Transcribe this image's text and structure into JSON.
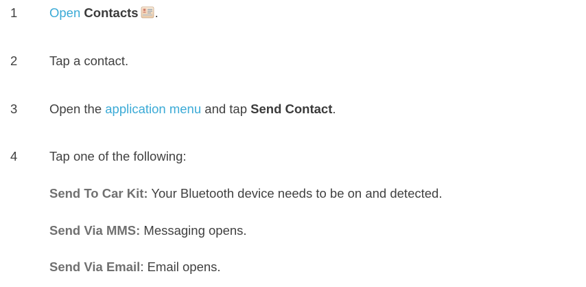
{
  "steps": [
    {
      "number": "1",
      "link": "Open",
      "space": " ",
      "bold": "Contacts",
      "icon": "contacts-app-icon",
      "end": "."
    },
    {
      "number": "2",
      "text": "Tap a contact."
    },
    {
      "number": "3",
      "prefix": "Open the ",
      "link": "application menu",
      "middle": " and tap ",
      "bold": "Send Contact",
      "end": "."
    },
    {
      "number": "4",
      "text": "Tap one of the following:"
    }
  ],
  "options": [
    {
      "label": "Send To Car Kit:",
      "text": " Your Bluetooth device needs to be on and detected."
    },
    {
      "label": "Send Via MMS:",
      "text": " Messaging opens."
    },
    {
      "label": "Send Via Email",
      "text": ": Email opens."
    }
  ],
  "colors": {
    "link": "#3aaad6",
    "body_text": "#404040",
    "option_label": "#707070"
  }
}
